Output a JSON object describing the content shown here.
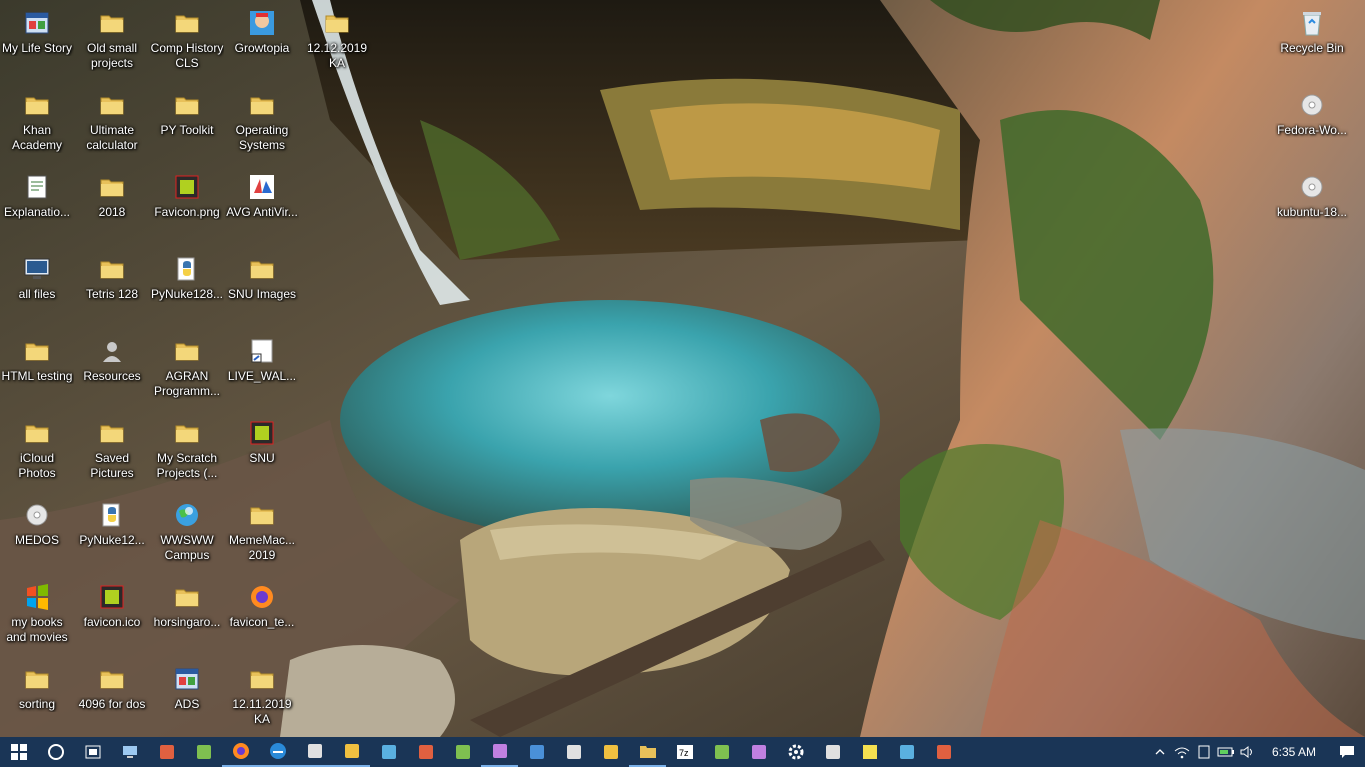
{
  "desktop": {
    "columns": [
      [
        {
          "label": "My Life Story",
          "icon": "app-icon"
        },
        {
          "label": "Khan Academy",
          "icon": "folder-icon"
        },
        {
          "label": "Explanatio...",
          "icon": "document-icon"
        },
        {
          "label": "all files",
          "icon": "monitor-shortcut-icon"
        },
        {
          "label": "HTML testing",
          "icon": "folder-icon"
        },
        {
          "label": "iCloud Photos",
          "icon": "folder-icon"
        },
        {
          "label": "MEDOS",
          "icon": "disc-icon"
        },
        {
          "label": "my books and movies",
          "icon": "windows-media-icon"
        },
        {
          "label": "sorting",
          "icon": "folder-icon"
        }
      ],
      [
        {
          "label": "Old small projects",
          "icon": "folder-icon"
        },
        {
          "label": "Ultimate calculator",
          "icon": "folder-icon"
        },
        {
          "label": "2018",
          "icon": "folder-icon"
        },
        {
          "label": "Tetris 128",
          "icon": "folder-icon"
        },
        {
          "label": "Resources",
          "icon": "user-icon"
        },
        {
          "label": "Saved Pictures",
          "icon": "folder-icon"
        },
        {
          "label": "PyNuke12...",
          "icon": "python-icon"
        },
        {
          "label": "favicon.ico",
          "icon": "image-icon"
        },
        {
          "label": "4096 for dos",
          "icon": "folder-icon"
        }
      ],
      [
        {
          "label": "Comp History CLS",
          "icon": "folder-icon"
        },
        {
          "label": "PY Toolkit",
          "icon": "folder-icon"
        },
        {
          "label": "Favicon.png",
          "icon": "image-icon"
        },
        {
          "label": "PyNuke128...",
          "icon": "python-icon"
        },
        {
          "label": "AGRAN Programm...",
          "icon": "folder-icon"
        },
        {
          "label": "My Scratch Projects (...",
          "icon": "folder-icon"
        },
        {
          "label": "WWSWW Campus",
          "icon": "globe-icon"
        },
        {
          "label": "horsingaro...",
          "icon": "folder-icon"
        },
        {
          "label": "ADS",
          "icon": "app-icon"
        }
      ],
      [
        {
          "label": "Growtopia",
          "icon": "game-icon"
        },
        {
          "label": "Operating Systems",
          "icon": "folder-icon"
        },
        {
          "label": "AVG AntiVir...",
          "icon": "antivirus-icon"
        },
        {
          "label": "SNU Images",
          "icon": "folder-icon"
        },
        {
          "label": "LIVE_WAL...",
          "icon": "shortcut-icon"
        },
        {
          "label": "SNU",
          "icon": "image-icon"
        },
        {
          "label": "MemeMac... 2019",
          "icon": "folder-icon"
        },
        {
          "label": "favicon_te...",
          "icon": "firefox-icon"
        },
        {
          "label": "12.11.2019 KA",
          "icon": "folder-icon"
        }
      ],
      [
        {
          "label": "12.12.2019 KA",
          "icon": "folder-icon"
        }
      ]
    ],
    "right": [
      {
        "label": "Recycle Bin",
        "icon": "recycle-bin-icon"
      },
      {
        "label": "Fedora-Wo...",
        "icon": "disc-icon"
      },
      {
        "label": "kubuntu-18...",
        "icon": "disc-icon"
      }
    ]
  },
  "taskbar": {
    "apps": [
      "start-icon",
      "cortana-icon",
      "task-view-icon",
      "this-pc-icon",
      "file-icon",
      "cloud-icon",
      "firefox-icon",
      "edge-icon",
      "notepad-icon",
      "calculator-icon",
      "paint-icon",
      "steam-icon",
      "app-icon",
      "gimp-icon",
      "python-icon",
      "store-icon",
      "settings-file-icon",
      "folder-icon",
      "7zip-icon",
      "paint-app-icon",
      "office-icon",
      "gear-icon",
      "bookmark-icon",
      "sticky-notes-icon",
      "film-icon",
      "remote-desktop-icon"
    ],
    "clock": "6:35 AM"
  },
  "colors": {
    "folder": "#e8c15a",
    "taskbar": "#1a3556",
    "accent": "#7ab0e8"
  }
}
